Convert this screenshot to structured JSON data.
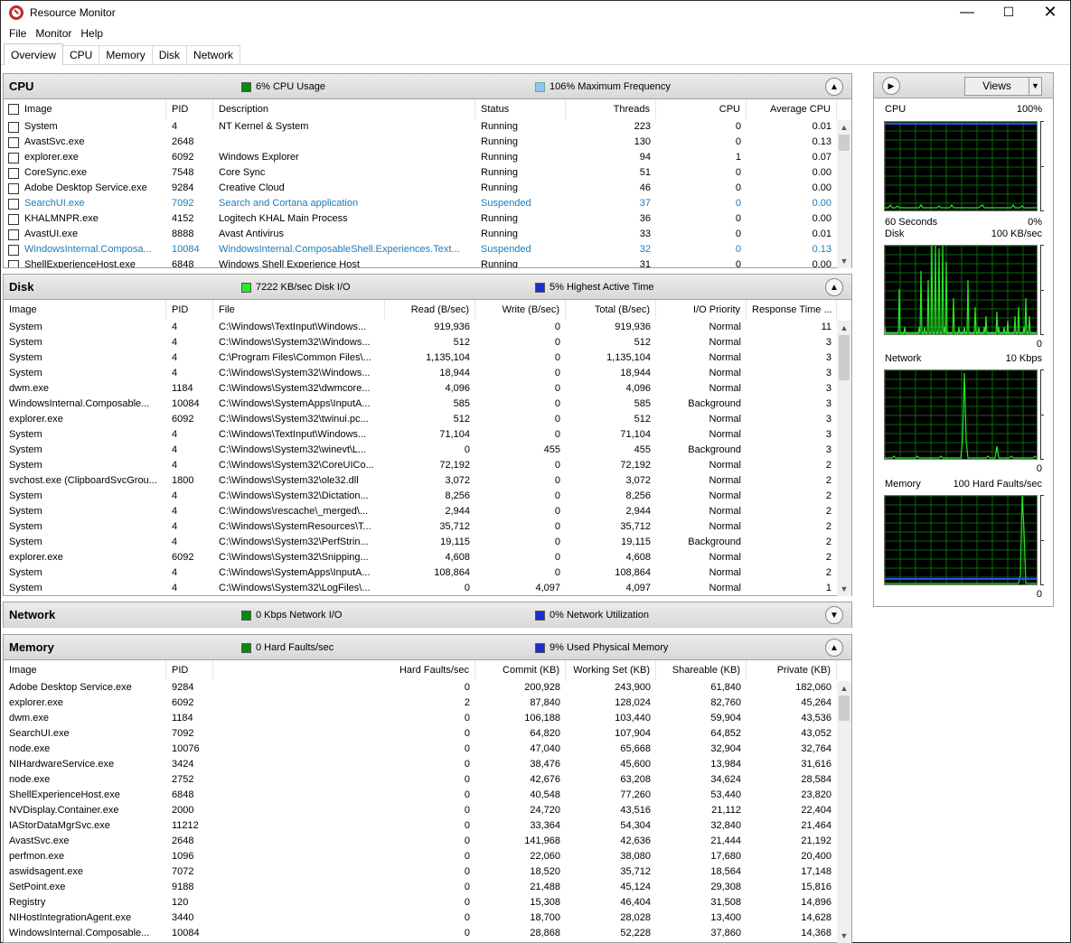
{
  "app": {
    "title": "Resource Monitor"
  },
  "menu": [
    "File",
    "Monitor",
    "Help"
  ],
  "tabs": [
    "Overview",
    "CPU",
    "Memory",
    "Disk",
    "Network"
  ],
  "cpu": {
    "title": "CPU",
    "stat1": "6% CPU Usage",
    "stat2": "106% Maximum Frequency",
    "headers": [
      "Image",
      "PID",
      "Description",
      "Status",
      "Threads",
      "CPU",
      "Average CPU"
    ],
    "rows": [
      {
        "image": "System",
        "pid": "4",
        "desc": "NT Kernel & System",
        "status": "Running",
        "threads": "223",
        "cpu": "0",
        "avg": "0.01",
        "susp": false
      },
      {
        "image": "AvastSvc.exe",
        "pid": "2648",
        "desc": "",
        "status": "Running",
        "threads": "130",
        "cpu": "0",
        "avg": "0.13",
        "susp": false
      },
      {
        "image": "explorer.exe",
        "pid": "6092",
        "desc": "Windows Explorer",
        "status": "Running",
        "threads": "94",
        "cpu": "1",
        "avg": "0.07",
        "susp": false
      },
      {
        "image": "CoreSync.exe",
        "pid": "7548",
        "desc": "Core Sync",
        "status": "Running",
        "threads": "51",
        "cpu": "0",
        "avg": "0.00",
        "susp": false
      },
      {
        "image": "Adobe Desktop Service.exe",
        "pid": "9284",
        "desc": "Creative Cloud",
        "status": "Running",
        "threads": "46",
        "cpu": "0",
        "avg": "0.00",
        "susp": false
      },
      {
        "image": "SearchUI.exe",
        "pid": "7092",
        "desc": "Search and Cortana application",
        "status": "Suspended",
        "threads": "37",
        "cpu": "0",
        "avg": "0.00",
        "susp": true
      },
      {
        "image": "KHALMNPR.exe",
        "pid": "4152",
        "desc": "Logitech KHAL Main Process",
        "status": "Running",
        "threads": "36",
        "cpu": "0",
        "avg": "0.00",
        "susp": false
      },
      {
        "image": "AvastUI.exe",
        "pid": "8888",
        "desc": "Avast Antivirus",
        "status": "Running",
        "threads": "33",
        "cpu": "0",
        "avg": "0.01",
        "susp": false
      },
      {
        "image": "WindowsInternal.Composa...",
        "pid": "10084",
        "desc": "WindowsInternal.ComposableShell.Experiences.Text...",
        "status": "Suspended",
        "threads": "32",
        "cpu": "0",
        "avg": "0.13",
        "susp": true
      },
      {
        "image": "ShellExperienceHost.exe",
        "pid": "6848",
        "desc": "Windows Shell Experience Host",
        "status": "Running",
        "threads": "31",
        "cpu": "0",
        "avg": "0.00",
        "susp": false
      }
    ]
  },
  "disk": {
    "title": "Disk",
    "stat1": "7222 KB/sec Disk I/O",
    "stat2": "5% Highest Active Time",
    "headers": [
      "Image",
      "PID",
      "File",
      "Read (B/sec)",
      "Write (B/sec)",
      "Total (B/sec)",
      "I/O Priority",
      "Response Time ..."
    ],
    "rows": [
      [
        "System",
        "4",
        "C:\\Windows\\TextInput\\Windows...",
        "919,936",
        "0",
        "919,936",
        "Normal",
        "11"
      ],
      [
        "System",
        "4",
        "C:\\Windows\\System32\\Windows...",
        "512",
        "0",
        "512",
        "Normal",
        "3"
      ],
      [
        "System",
        "4",
        "C:\\Program Files\\Common Files\\...",
        "1,135,104",
        "0",
        "1,135,104",
        "Normal",
        "3"
      ],
      [
        "System",
        "4",
        "C:\\Windows\\System32\\Windows...",
        "18,944",
        "0",
        "18,944",
        "Normal",
        "3"
      ],
      [
        "dwm.exe",
        "1184",
        "C:\\Windows\\System32\\dwmcore...",
        "4,096",
        "0",
        "4,096",
        "Normal",
        "3"
      ],
      [
        "WindowsInternal.Composable...",
        "10084",
        "C:\\Windows\\SystemApps\\InputA...",
        "585",
        "0",
        "585",
        "Background",
        "3"
      ],
      [
        "explorer.exe",
        "6092",
        "C:\\Windows\\System32\\twinui.pc...",
        "512",
        "0",
        "512",
        "Normal",
        "3"
      ],
      [
        "System",
        "4",
        "C:\\Windows\\TextInput\\Windows...",
        "71,104",
        "0",
        "71,104",
        "Normal",
        "3"
      ],
      [
        "System",
        "4",
        "C:\\Windows\\System32\\winevt\\L...",
        "0",
        "455",
        "455",
        "Background",
        "3"
      ],
      [
        "System",
        "4",
        "C:\\Windows\\System32\\CoreUICo...",
        "72,192",
        "0",
        "72,192",
        "Normal",
        "2"
      ],
      [
        "svchost.exe (ClipboardSvcGrou...",
        "1800",
        "C:\\Windows\\System32\\ole32.dll",
        "3,072",
        "0",
        "3,072",
        "Normal",
        "2"
      ],
      [
        "System",
        "4",
        "C:\\Windows\\System32\\Dictation...",
        "8,256",
        "0",
        "8,256",
        "Normal",
        "2"
      ],
      [
        "System",
        "4",
        "C:\\Windows\\rescache\\_merged\\...",
        "2,944",
        "0",
        "2,944",
        "Normal",
        "2"
      ],
      [
        "System",
        "4",
        "C:\\Windows\\SystemResources\\T...",
        "35,712",
        "0",
        "35,712",
        "Normal",
        "2"
      ],
      [
        "System",
        "4",
        "C:\\Windows\\System32\\PerfStrin...",
        "19,115",
        "0",
        "19,115",
        "Background",
        "2"
      ],
      [
        "explorer.exe",
        "6092",
        "C:\\Windows\\System32\\Snipping...",
        "4,608",
        "0",
        "4,608",
        "Normal",
        "2"
      ],
      [
        "System",
        "4",
        "C:\\Windows\\SystemApps\\InputA...",
        "108,864",
        "0",
        "108,864",
        "Normal",
        "2"
      ],
      [
        "System",
        "4",
        "C:\\Windows\\System32\\LogFiles\\...",
        "0",
        "4,097",
        "4,097",
        "Normal",
        "1"
      ]
    ]
  },
  "network": {
    "title": "Network",
    "stat1": "0 Kbps Network I/O",
    "stat2": "0% Network Utilization"
  },
  "memory": {
    "title": "Memory",
    "stat1": "0 Hard Faults/sec",
    "stat2": "9% Used Physical Memory",
    "headers": [
      "Image",
      "PID",
      "Hard Faults/sec",
      "Commit (KB)",
      "Working Set (KB)",
      "Shareable (KB)",
      "Private (KB)"
    ],
    "rows": [
      [
        "Adobe Desktop Service.exe",
        "9284",
        "0",
        "200,928",
        "243,900",
        "61,840",
        "182,060"
      ],
      [
        "explorer.exe",
        "6092",
        "2",
        "87,840",
        "128,024",
        "82,760",
        "45,264"
      ],
      [
        "dwm.exe",
        "1184",
        "0",
        "106,188",
        "103,440",
        "59,904",
        "43,536"
      ],
      [
        "SearchUI.exe",
        "7092",
        "0",
        "64,820",
        "107,904",
        "64,852",
        "43,052"
      ],
      [
        "node.exe",
        "10076",
        "0",
        "47,040",
        "65,668",
        "32,904",
        "32,764"
      ],
      [
        "NIHardwareService.exe",
        "3424",
        "0",
        "38,476",
        "45,600",
        "13,984",
        "31,616"
      ],
      [
        "node.exe",
        "2752",
        "0",
        "42,676",
        "63,208",
        "34,624",
        "28,584"
      ],
      [
        "ShellExperienceHost.exe",
        "6848",
        "0",
        "40,548",
        "77,260",
        "53,440",
        "23,820"
      ],
      [
        "NVDisplay.Container.exe",
        "2000",
        "0",
        "24,720",
        "43,516",
        "21,112",
        "22,404"
      ],
      [
        "IAStorDataMgrSvc.exe",
        "11212",
        "0",
        "33,364",
        "54,304",
        "32,840",
        "21,464"
      ],
      [
        "AvastSvc.exe",
        "2648",
        "0",
        "141,968",
        "42,636",
        "21,444",
        "21,192"
      ],
      [
        "perfmon.exe",
        "1096",
        "0",
        "22,060",
        "38,080",
        "17,680",
        "20,400"
      ],
      [
        "aswidsagent.exe",
        "7072",
        "0",
        "18,520",
        "35,712",
        "18,564",
        "17,148"
      ],
      [
        "SetPoint.exe",
        "9188",
        "0",
        "21,488",
        "45,124",
        "29,308",
        "15,816"
      ],
      [
        "Registry",
        "120",
        "0",
        "15,308",
        "46,404",
        "31,508",
        "14,896"
      ],
      [
        "NIHostIntegrationAgent.exe",
        "3440",
        "0",
        "18,700",
        "28,028",
        "13,400",
        "14,628"
      ],
      [
        "WindowsInternal.Composable...",
        "10084",
        "0",
        "28,868",
        "52,228",
        "37,860",
        "14,368"
      ]
    ]
  },
  "side": {
    "views_label": "Views",
    "graphs": [
      {
        "name": "CPU",
        "max": "100%",
        "left": "60 Seconds",
        "right": "0%"
      },
      {
        "name": "Disk",
        "max": "100 KB/sec",
        "left": "",
        "right": "0"
      },
      {
        "name": "Network",
        "max": "10 Kbps",
        "left": "",
        "right": "0"
      },
      {
        "name": "Memory",
        "max": "100 Hard Faults/sec",
        "left": "",
        "right": "0"
      }
    ]
  },
  "colors": {
    "green": "#00c000",
    "blue": "#1a2fcf",
    "susp": "#1f7ab8"
  }
}
